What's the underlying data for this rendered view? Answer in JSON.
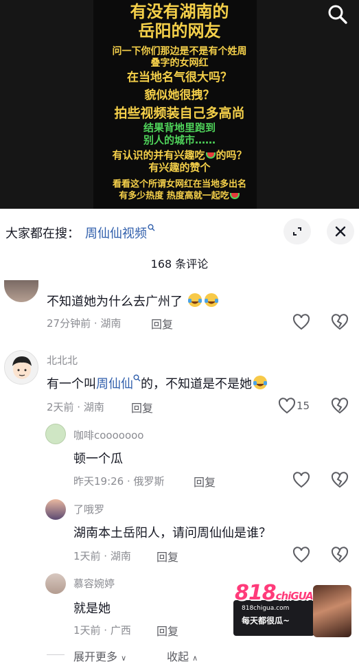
{
  "video": {
    "lines": [
      {
        "text": "有没有湖南的",
        "color": "#f5d04a"
      },
      {
        "text": "岳阳的网友",
        "color": "#f5d04a"
      },
      {
        "text": "问一下你们那边是不是有个姓周",
        "color": "#f5d04a"
      },
      {
        "text": "叠字的女网红",
        "color": "#f5d04a"
      },
      {
        "text": "在当地名气很大吗？",
        "color": "#f5d04a"
      },
      {
        "text": "貌似她很拽？",
        "color": "#f5d04a"
      },
      {
        "text": "拍些视频装自己多高尚",
        "color": "#f5d04a"
      },
      {
        "text": "结果背地里跑到",
        "color": "#4fd35a"
      },
      {
        "text": "别人的城市……",
        "color": "#4fd35a"
      },
      {
        "text": "有认识的并有兴趣吃",
        "color": "#f5d04a"
      },
      {
        "text": "的吗？",
        "color": "#f5d04a"
      },
      {
        "text": "有兴趣的赞个",
        "color": "#f5d04a"
      },
      {
        "text": "看看这个所谓女网红在当地多出名",
        "color": "#f5d04a"
      },
      {
        "text": "有多少热度 热度高就一起吃",
        "color": "#f5d04a"
      }
    ],
    "search_icon": "search-icon"
  },
  "search_bar": {
    "prefix": "大家都在搜：",
    "term": "周仙仙视频"
  },
  "comment_count": "168 条评论",
  "comments": [
    {
      "text": "不知道她为什么去广州了",
      "time_location": "27分钟前 · 湖南",
      "reply": "回复"
    },
    {
      "name": "北北北",
      "text_before": "有一个叫",
      "mention": "周仙仙",
      "text_after": "的，不知道是不是她",
      "time_location": "2天前 · 湖南",
      "reply": "回复",
      "likes": "15"
    },
    {
      "name": "咖啡cooooooo",
      "text": "顿一个瓜",
      "time_location": "昨天19:26 · 俄罗斯",
      "reply": "回复"
    },
    {
      "name": "了哦罗",
      "text": "湖南本土岳阳人，请问周仙仙是谁？",
      "time_location": "1天前 · 湖南",
      "reply": "回复"
    },
    {
      "name": "慕容婉婷",
      "text": "就是她",
      "time_location": "1天前 · 广西",
      "reply": "回复"
    }
  ],
  "footer": {
    "expand_more": "展开更多",
    "collapse": "收起"
  },
  "watermark": {
    "logo": "818",
    "logo_sub": "chiGUA",
    "url": "818chigua.com",
    "slogan": "每天都很瓜~"
  },
  "colors": {
    "video_text_yellow": "#f5d04a",
    "video_text_green": "#4fd35a",
    "link_blue": "#2f5eab",
    "meta_gray": "#8a8b91"
  }
}
